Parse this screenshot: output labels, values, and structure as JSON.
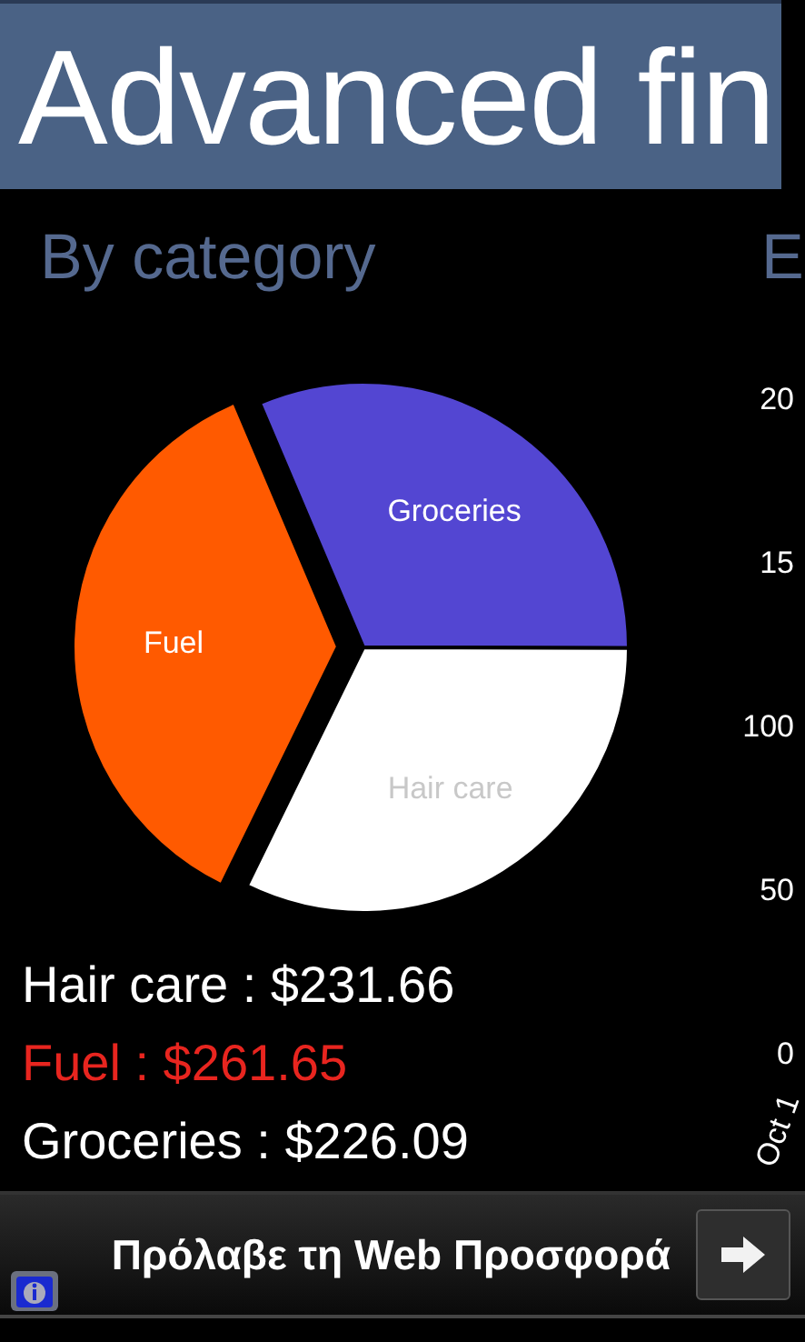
{
  "header": {
    "title": "Advanced fin"
  },
  "category_panel": {
    "heading": "By category",
    "chart_data": {
      "type": "pie",
      "categories": [
        "Groceries",
        "Hair care",
        "Fuel"
      ],
      "values": [
        31.43,
        32.2,
        36.37
      ],
      "colors": [
        "#5346d2",
        "#ffffff",
        "#ff5a00"
      ]
    },
    "legend": [
      {
        "text": "Hair care : $231.66",
        "selected": false
      },
      {
        "text": "Fuel : $261.65",
        "selected": true
      },
      {
        "text": "Groceries : $226.09",
        "selected": false
      }
    ]
  },
  "side_panel": {
    "heading": "E",
    "axis_labels": [
      "20",
      "15",
      "100",
      "50",
      "0"
    ],
    "x_label": "Oct 1"
  },
  "ad_banner": {
    "text": "Πρόλαβε τη Web Προσφορά"
  }
}
